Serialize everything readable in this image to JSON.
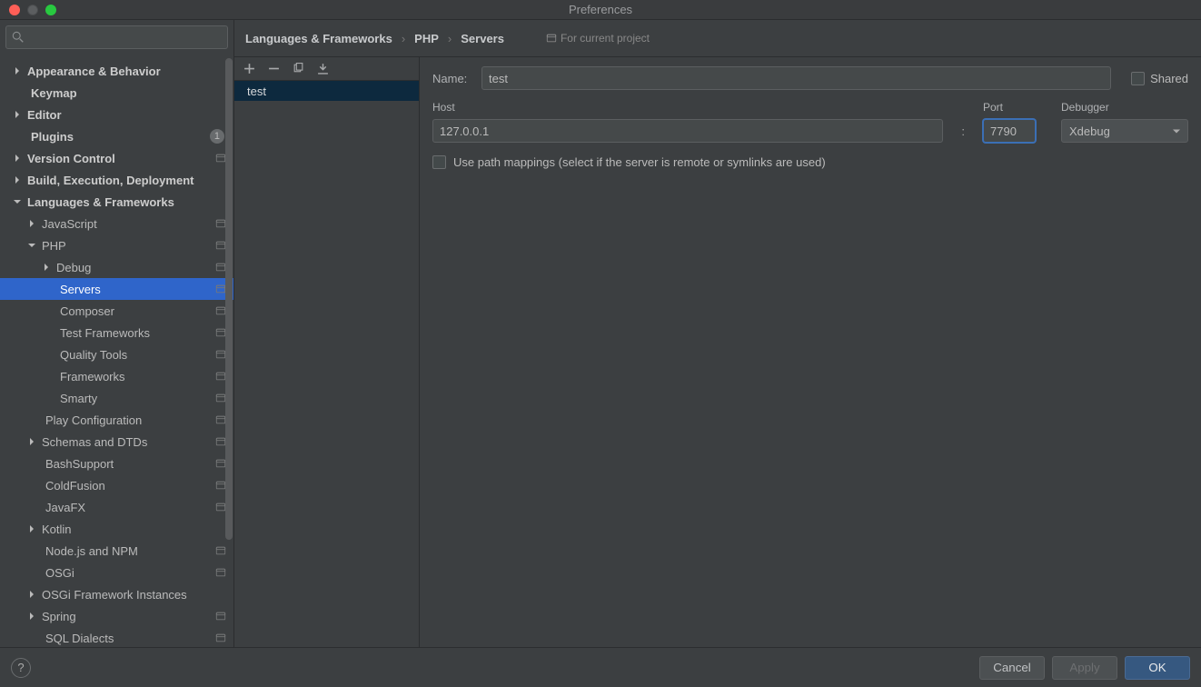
{
  "window": {
    "title": "Preferences"
  },
  "search": {
    "placeholder": ""
  },
  "tree": [
    {
      "label": "Appearance & Behavior",
      "depth": 0,
      "arrow": "right",
      "bold": true
    },
    {
      "label": "Keymap",
      "depth": 0,
      "arrow": "",
      "bold": true
    },
    {
      "label": "Editor",
      "depth": 0,
      "arrow": "right",
      "bold": true
    },
    {
      "label": "Plugins",
      "depth": 0,
      "arrow": "",
      "bold": true,
      "badge": "1"
    },
    {
      "label": "Version Control",
      "depth": 0,
      "arrow": "right",
      "bold": true,
      "proj": true
    },
    {
      "label": "Build, Execution, Deployment",
      "depth": 0,
      "arrow": "right",
      "bold": true
    },
    {
      "label": "Languages & Frameworks",
      "depth": 0,
      "arrow": "down",
      "bold": true
    },
    {
      "label": "JavaScript",
      "depth": 1,
      "arrow": "right",
      "proj": true
    },
    {
      "label": "PHP",
      "depth": 1,
      "arrow": "down",
      "proj": true
    },
    {
      "label": "Debug",
      "depth": 2,
      "arrow": "right",
      "proj": true
    },
    {
      "label": "Servers",
      "depth": 2,
      "arrow": "",
      "proj": true,
      "selected": true
    },
    {
      "label": "Composer",
      "depth": 2,
      "arrow": "",
      "proj": true
    },
    {
      "label": "Test Frameworks",
      "depth": 2,
      "arrow": "",
      "proj": true
    },
    {
      "label": "Quality Tools",
      "depth": 2,
      "arrow": "",
      "proj": true
    },
    {
      "label": "Frameworks",
      "depth": 2,
      "arrow": "",
      "proj": true
    },
    {
      "label": "Smarty",
      "depth": 2,
      "arrow": "",
      "proj": true
    },
    {
      "label": "Play Configuration",
      "depth": 1,
      "arrow": "",
      "proj": true
    },
    {
      "label": "Schemas and DTDs",
      "depth": 1,
      "arrow": "right",
      "proj": true
    },
    {
      "label": "BashSupport",
      "depth": 1,
      "arrow": "",
      "proj": true
    },
    {
      "label": "ColdFusion",
      "depth": 1,
      "arrow": "",
      "proj": true
    },
    {
      "label": "JavaFX",
      "depth": 1,
      "arrow": "",
      "proj": true
    },
    {
      "label": "Kotlin",
      "depth": 1,
      "arrow": "right"
    },
    {
      "label": "Node.js and NPM",
      "depth": 1,
      "arrow": "",
      "proj": true
    },
    {
      "label": "OSGi",
      "depth": 1,
      "arrow": "",
      "proj": true
    },
    {
      "label": "OSGi Framework Instances",
      "depth": 1,
      "arrow": "right"
    },
    {
      "label": "Spring",
      "depth": 1,
      "arrow": "right",
      "proj": true
    },
    {
      "label": "SQL Dialects",
      "depth": 1,
      "arrow": "",
      "proj": true
    }
  ],
  "breadcrumb": [
    "Languages & Frameworks",
    "PHP",
    "Servers"
  ],
  "scope": "For current project",
  "servers": {
    "items": [
      "test"
    ],
    "selected": 0
  },
  "form": {
    "name_label": "Name:",
    "name_value": "test",
    "shared_label": "Shared",
    "host_label": "Host",
    "host_value": "127.0.0.1",
    "port_label": "Port",
    "port_value": "7790",
    "debugger_label": "Debugger",
    "debugger_value": "Xdebug",
    "path_mappings_label": "Use path mappings (select if the server is remote or symlinks are used)"
  },
  "buttons": {
    "cancel": "Cancel",
    "apply": "Apply",
    "ok": "OK"
  }
}
